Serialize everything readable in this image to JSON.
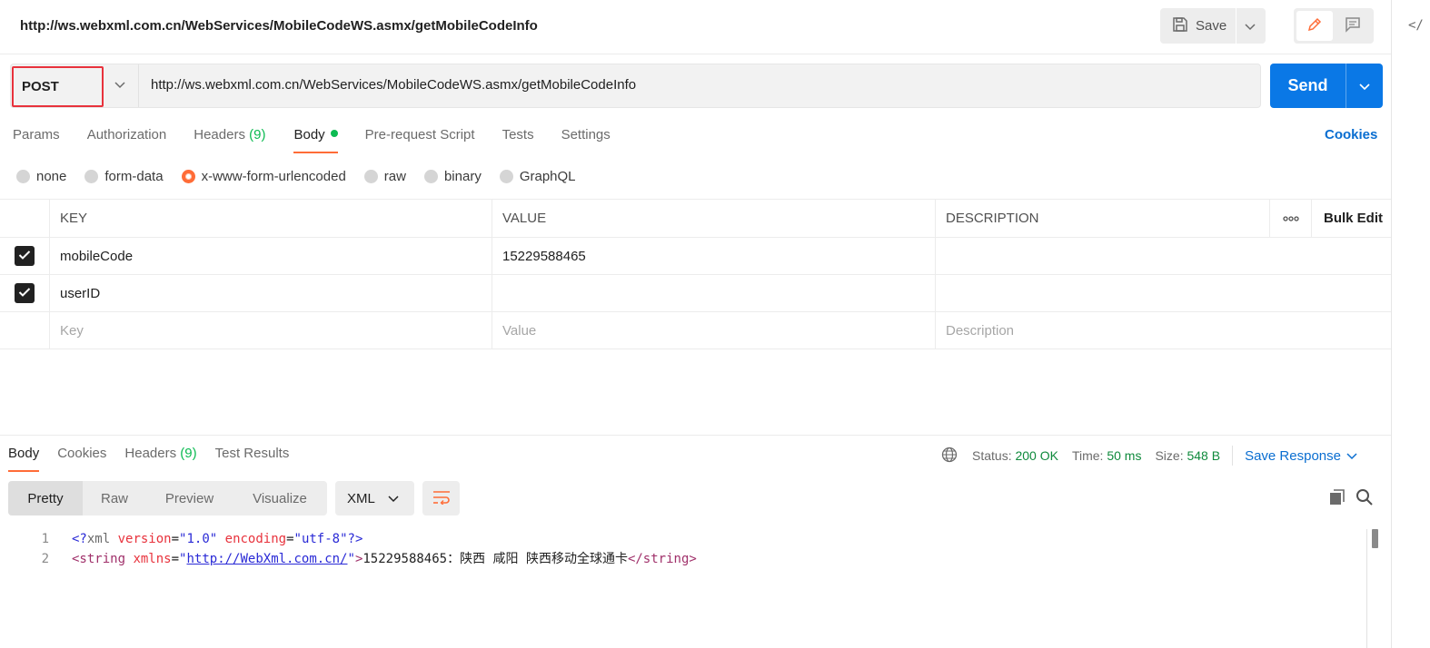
{
  "header": {
    "title": "http://ws.webxml.com.cn/WebServices/MobileCodeWS.asmx/getMobileCodeInfo",
    "save_label": "Save",
    "code_glyph": "</"
  },
  "request": {
    "method": "POST",
    "url": "http://ws.webxml.com.cn/WebServices/MobileCodeWS.asmx/getMobileCodeInfo",
    "send_label": "Send"
  },
  "tabs": [
    {
      "label": "Params"
    },
    {
      "label": "Authorization"
    },
    {
      "label": "Headers",
      "count": "(9)"
    },
    {
      "label": "Body",
      "active": true
    },
    {
      "label": "Pre-request Script"
    },
    {
      "label": "Tests"
    },
    {
      "label": "Settings"
    }
  ],
  "cookies_label": "Cookies",
  "body_modes": [
    {
      "label": "none",
      "selected": false
    },
    {
      "label": "form-data",
      "selected": false
    },
    {
      "label": "x-www-form-urlencoded",
      "selected": true
    },
    {
      "label": "raw",
      "selected": false
    },
    {
      "label": "binary",
      "selected": false
    },
    {
      "label": "GraphQL",
      "selected": false
    }
  ],
  "table": {
    "headers": {
      "key": "KEY",
      "value": "VALUE",
      "description": "DESCRIPTION",
      "more": "◦◦◦",
      "bulk_edit": "Bulk Edit"
    },
    "rows": [
      {
        "checked": true,
        "key": "mobileCode",
        "value": "15229588465",
        "description": ""
      },
      {
        "checked": true,
        "key": "userID",
        "value": "",
        "description": ""
      }
    ],
    "placeholders": {
      "key": "Key",
      "value": "Value",
      "description": "Description"
    }
  },
  "response": {
    "tabs": [
      {
        "label": "Body",
        "active": true
      },
      {
        "label": "Cookies"
      },
      {
        "label": "Headers",
        "count": "(9)"
      },
      {
        "label": "Test Results"
      }
    ],
    "status_label": "Status:",
    "status_value": "200 OK",
    "time_label": "Time:",
    "time_value": "50 ms",
    "size_label": "Size:",
    "size_value": "548 B",
    "save_response": "Save Response",
    "view_tabs": [
      "Pretty",
      "Raw",
      "Preview",
      "Visualize"
    ],
    "format": "XML",
    "code": {
      "line1_no": "1",
      "line2_no": "2",
      "decl_open": "<?",
      "decl_name": "xml",
      "decl_attr1": "version",
      "decl_val1": "\"1.0\"",
      "decl_attr2": "encoding",
      "decl_val2": "\"utf-8\"",
      "decl_close": "?>",
      "tag_open": "<string",
      "tag_attr": "xmlns",
      "tag_val_quote_open": "\"",
      "tag_val_link": "http://WebXml.com.cn/",
      "tag_val_quote_close": "\"",
      "tag_gt": ">",
      "text": "15229588465：陕西 咸阳 陕西移动全球通卡",
      "close_tag": "</string>"
    }
  }
}
